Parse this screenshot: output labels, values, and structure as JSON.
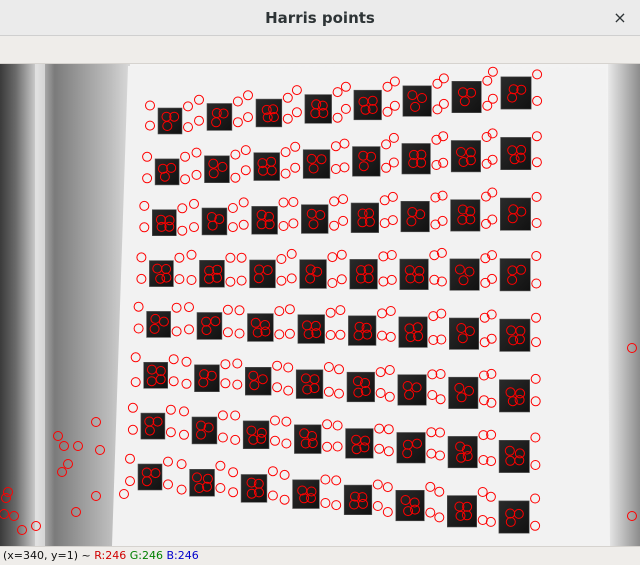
{
  "window": {
    "title": "Harris points",
    "close_glyph": "×"
  },
  "status": {
    "coords": "(x=340, y=1) ~",
    "r": "R:246",
    "g": "G:246",
    "b": "B:246",
    "r_color": "#d00000",
    "g_color": "#008000",
    "b_color": "#0000cc"
  },
  "image": {
    "description_kind": "grayscale calibration checkerboard photo",
    "marker_color": "#ff0000",
    "board_color": "#f2f2f2",
    "square_color": "#222222",
    "grid_rows": 8,
    "grid_cols": 8
  }
}
